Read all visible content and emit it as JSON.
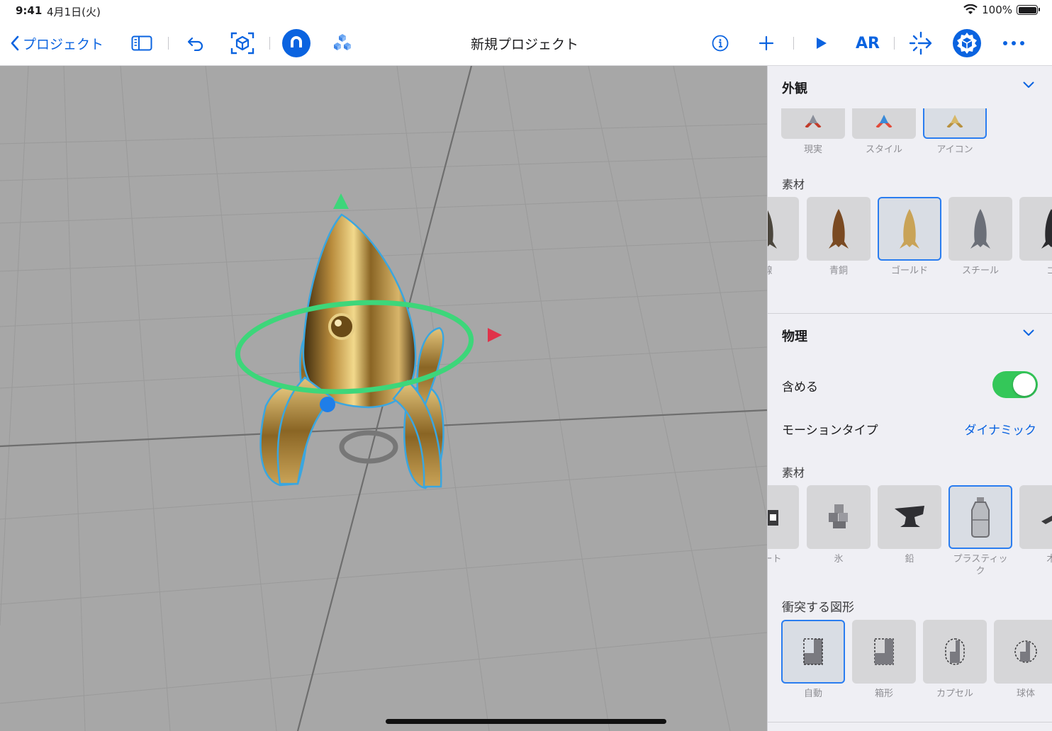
{
  "status_bar": {
    "time": "9:41",
    "date": "4月1日(火)",
    "battery": "100%"
  },
  "toolbar": {
    "back_label": "プロジェクト",
    "title": "新規プロジェクト",
    "ar_label": "AR",
    "accent_color": "#0a63e0"
  },
  "inspector": {
    "appearance": {
      "title": "外観",
      "styles": [
        {
          "label": "現実"
        },
        {
          "label": "スタイル"
        },
        {
          "label": "アイコン",
          "selected": true
        }
      ],
      "material_label": "素材",
      "materials": [
        {
          "label": "線"
        },
        {
          "label": "青銅"
        },
        {
          "label": "ゴールド",
          "selected": true
        },
        {
          "label": "スチール"
        },
        {
          "label": "ゴ"
        }
      ]
    },
    "physics": {
      "title": "物理",
      "include_label": "含める",
      "include_on": true,
      "motion_type_label": "モーションタイプ",
      "motion_type_value": "ダイナミック",
      "material_label": "素材",
      "materials": [
        {
          "label": "リート"
        },
        {
          "label": "氷"
        },
        {
          "label": "鉛"
        },
        {
          "label": "プラスティッ\nク",
          "selected": true
        },
        {
          "label": "木"
        }
      ],
      "collision_label": "衝突する図形",
      "shapes": [
        {
          "label": "自動",
          "selected": true
        },
        {
          "label": "箱形"
        },
        {
          "label": "カプセル"
        },
        {
          "label": "球体"
        }
      ]
    }
  }
}
